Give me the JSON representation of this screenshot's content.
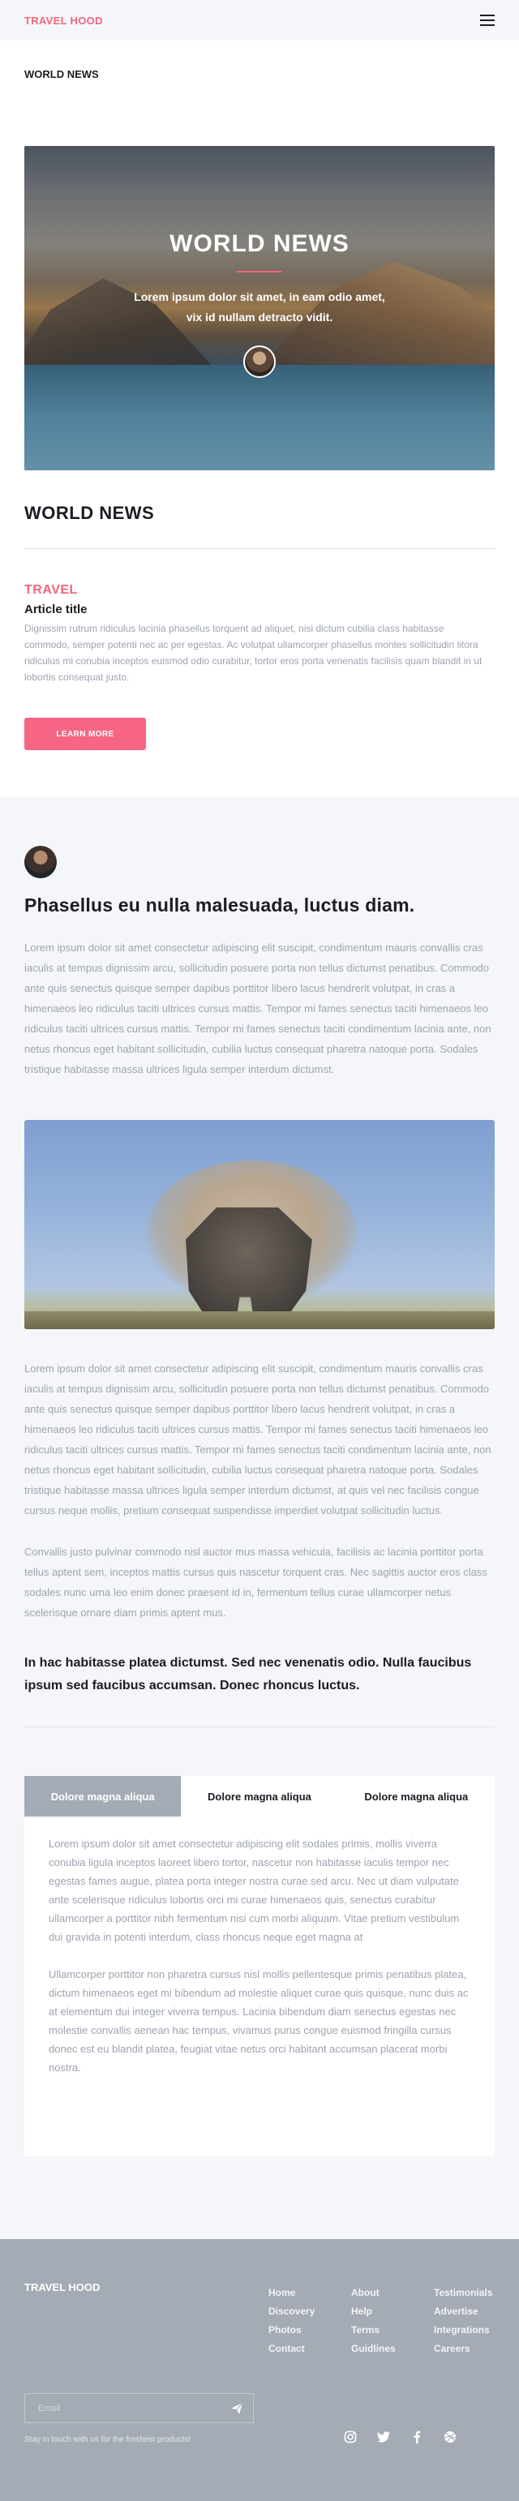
{
  "header": {
    "brand": "TRAVEL HOOD",
    "menu_icon": "hamburger-menu-icon"
  },
  "section_label": "WORLD NEWS",
  "hero": {
    "title": "WORLD NEWS",
    "text": "Lorem ipsum dolor sit amet, in eam odio amet, vix id nullam detracto vidit."
  },
  "news_heading": "WORLD NEWS",
  "article": {
    "category": "TRAVEL",
    "title": "Article title",
    "text": "Dignissim rutrum ridiculus lacinia phasellus torquent ad aliquet, nisi dictum cubilia class habitasse commodo, semper potenti nec ac per egestas. Ac volutpat ullamcorper phasellus montes sollicitudin litora ridiculus mi conubia inceptos euismod odio curabitur, tortor eros porta venenatis facilisis quam blandit in ut lobortis consequat justo.",
    "button": "LEARN MORE"
  },
  "post": {
    "title": "Phasellus eu nulla malesuada, luctus diam.",
    "paragraph1": "Lorem ipsum dolor sit amet consectetur adipiscing elit suscipit, condimentum mauris convallis cras iaculis at tempus dignissim arcu, sollicitudin posuere porta non tellus dictumst penatibus. Commodo ante quis senectus quisque semper dapibus porttitor libero lacus hendrerit volutpat, in cras a himenaeos leo ridiculus taciti ultrices cursus mattis. Tempor mi fames senectus taciti himenaeos leo ridiculus taciti ultrices cursus mattis. Tempor mi fames senectus taciti condimentum lacinia ante, non netus rhoncus eget habitant sollicitudin, cubilia luctus consequat pharetra natoque porta. Sodales tristique habitasse massa ultrices ligula semper interdum dictumst.",
    "paragraph2": "Lorem ipsum dolor sit amet consectetur adipiscing elit suscipit, condimentum mauris convallis cras iaculis at tempus dignissim arcu, sollicitudin posuere porta non tellus dictumst penatibus. Commodo ante quis senectus quisque semper dapibus porttitor libero lacus hendrerit volutpat, in cras a himenaeos leo ridiculus taciti ultrices cursus mattis. Tempor mi fames senectus taciti himenaeos leo ridiculus taciti ultrices cursus mattis. Tempor mi fames senectus taciti condimentum lacinia ante, non netus rhoncus eget habitant sollicitudin, cubilia luctus consequat pharetra natoque porta. Sodales tristique habitasse massa ultrices ligula semper interdum dictumst, at quis vel nec facilisis congue cursus neque mollis, pretium consequat suspendisse imperdiet volutpat sollicitudin luctus.",
    "paragraph3": "Convallis justo pulvinar commodo nisl auctor mus massa vehicula, facilisis ac lacinia porttitor porta tellus aptent sem, inceptos mattis cursus quis nascetur torquent cras. Nec sagittis auctor eros class sodales nunc urna leo enim donec praesent id in, fermentum tellus curae ullamcorper netus scelerisque ornare diam primis aptent mus.",
    "quote": "In hac habitasse platea dictumst. Sed nec venenatis odio. Nulla faucibus ipsum sed faucibus accumsan. Donec rhoncus luctus."
  },
  "tabs": {
    "items": [
      {
        "label": "Dolore magna aliqua"
      },
      {
        "label": "Dolore magna aliqua"
      },
      {
        "label": "Dolore magna aliqua"
      }
    ],
    "active_index": 0,
    "content": {
      "p1": "Lorem ipsum dolor sit amet consectetur adipiscing elit sodales primis, mollis viverra conubia ligula inceptos laoreet libero tortor, nascetur non habitasse iaculis tempor nec egestas fames augue, platea porta integer nostra curae sed arcu. Nec ut diam vulputate ante scelerisque ridiculus lobortis orci mi curae himenaeos quis, senectus curabitur ullamcorper a porttitor nibh fermentum nisi cum morbi aliquam. Vitae pretium vestibulum dui gravida in potenti interdum, class rhoncus neque eget magna at",
      "p2": "Ullamcorper porttitor non pharetra cursus nisl mollis pellentesque primis penatibus platea, dictum himenaeos eget mi bibendum ad molestie aliquet curae quis quisque, nunc duis ac at elementum dui integer viverra tempus. Lacinia bibendum diam senectus egestas nec molestie convallis aenean hac tempus, vivamus purus congue euismod fringilla cursus donec est eu blandit platea, feugiat vitae netus orci habitant accumsan placerat morbi nostra."
    }
  },
  "footer": {
    "brand": "TRAVEL HOOD",
    "columns": [
      [
        "Home",
        "Discovery",
        "Photos",
        "Contact"
      ],
      [
        "About",
        "Help",
        "Terms",
        "Guidlines"
      ],
      [
        "Testimonials",
        "Advertise",
        "Integrations",
        "Careers"
      ]
    ],
    "email_placeholder": "Email",
    "send_icon": "send-arrow-icon",
    "stay_text": "Stay in touch with us for the freshest products!",
    "socials": [
      "instagram-icon",
      "twitter-icon",
      "facebook-icon",
      "dribbble-icon"
    ]
  },
  "colors": {
    "accent": "#f0667e",
    "button": "#f66583",
    "section_bg": "#f5f6f9",
    "footer_bg": "#a5abb4",
    "muted_text": "#9ea3b0"
  }
}
